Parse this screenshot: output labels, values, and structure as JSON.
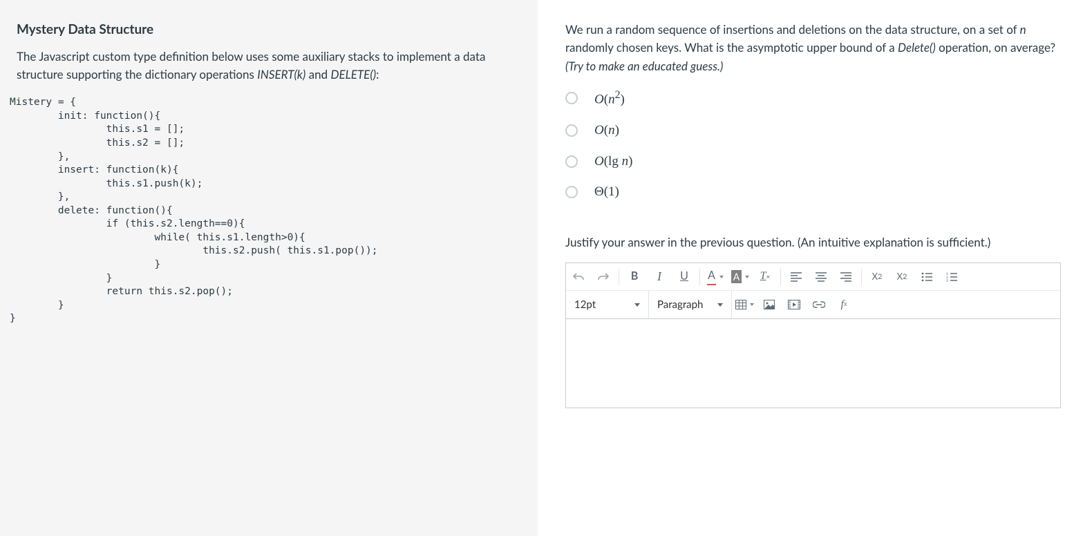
{
  "left": {
    "title": "Mystery Data Structure",
    "intro_pre": "The Javascript custom type definition below uses some auxiliary stacks to implement a data structure supporting the dictionary operations ",
    "op1": "INSERT(k)",
    "intro_mid": " and ",
    "op2": "DELETE()",
    "intro_end": ":",
    "code": "Mistery = {\n        init: function(){\n                this.s1 = [];\n                this.s2 = [];\n        },\n        insert: function(k){\n                this.s1.push(k);\n        },\n        delete: function(){\n                if (this.s2.length==0){\n                        while( this.s1.length>0){\n                                this.s2.push( this.s1.pop());\n                        }\n                }\n                return this.s2.pop();\n        }\n}"
  },
  "q1": {
    "text_pre": "We run a random sequence of insertions and deletions on the data structure, on a set of ",
    "var": "n",
    "text_mid": " randomly chosen keys.  What is the asymptotic upper bound of a ",
    "fn": "Delete()",
    "text_post": " operation, on average? ",
    "hint": "(Try to make an educated guess.)",
    "options": [
      {
        "html": "<i>O</i>(<i>n</i><sup>2</sup>)"
      },
      {
        "html": "<i>O</i>(<i>n</i>)"
      },
      {
        "html": "<i>O</i>(lg <i>n</i>)"
      },
      {
        "html": "Θ(1)"
      }
    ]
  },
  "q2": {
    "text": "Justify your answer in the previous question. (An intuitive explanation is sufficient.)"
  },
  "editor": {
    "font_size": "12pt",
    "block": "Paragraph"
  }
}
